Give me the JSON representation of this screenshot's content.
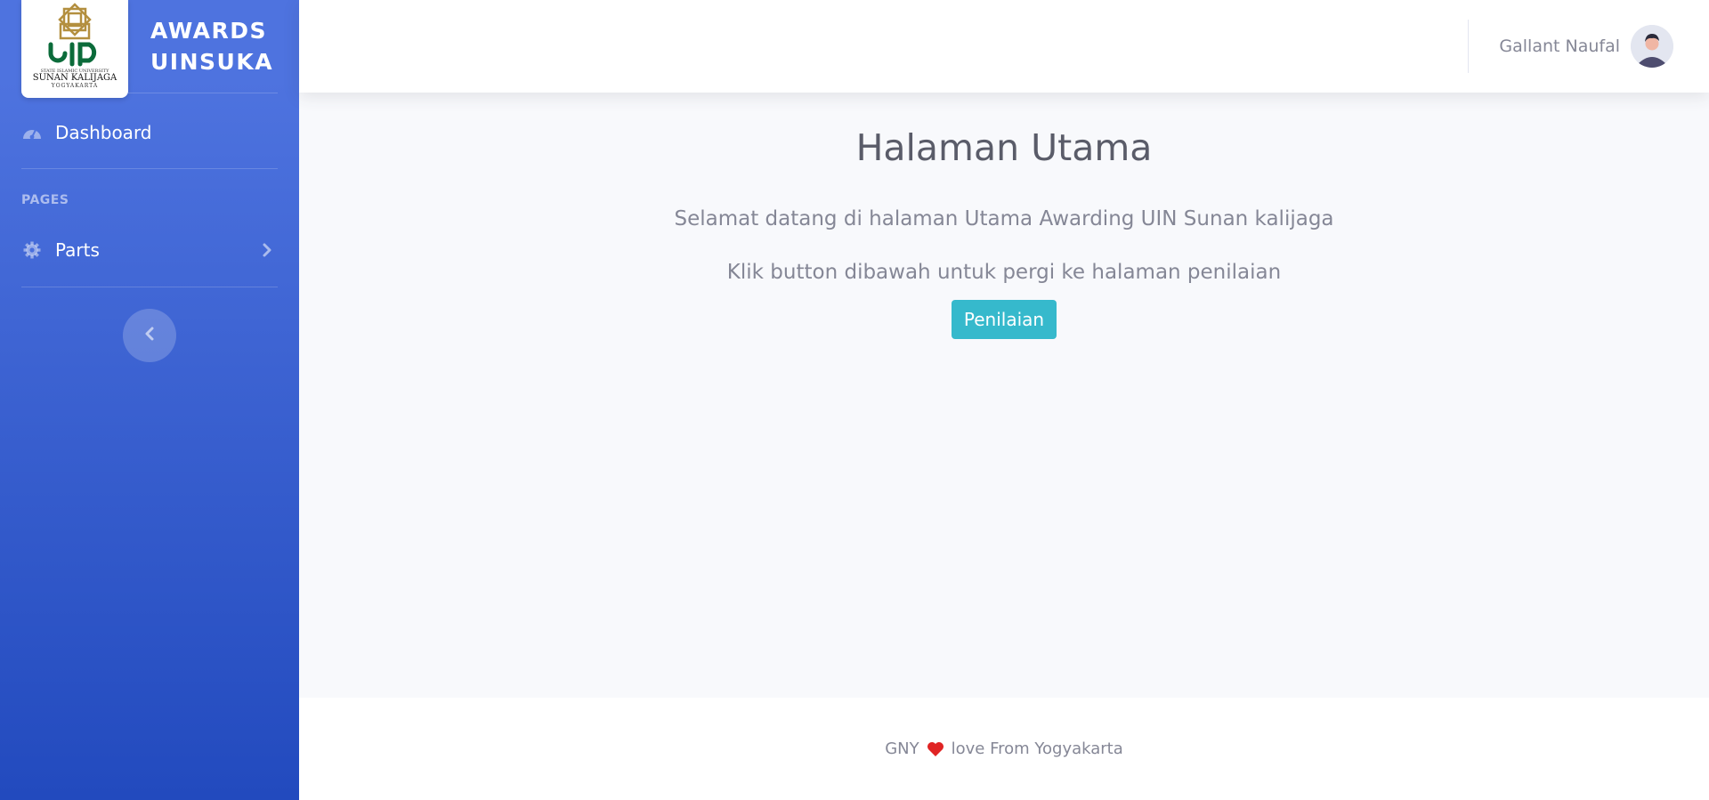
{
  "sidebar": {
    "brand": {
      "logo_text": [
        "STATE ISLAMIC UNIVERSITY",
        "SUNAN KALIJAGA",
        "YOGYAKARTA"
      ],
      "title": "AWARDS\nUINSUKA"
    },
    "items": [
      {
        "label": "Dashboard",
        "icon": "tachometer-icon"
      },
      {
        "heading": "PAGES"
      },
      {
        "label": "Parts",
        "icon": "gear-icon",
        "has_chevron": true
      }
    ],
    "toggle_icon": "chevron-left-icon",
    "colors": {
      "gradient_start": "#4e73df",
      "gradient_end": "#224abe"
    }
  },
  "topbar": {
    "user_name": "Gallant Naufal",
    "avatar_icon": "user-avatar"
  },
  "main": {
    "title": "Halaman Utama",
    "welcome_text": "Selamat datang di halaman Utama Awarding UIN Sunan kalijaga",
    "instruction_text": "Klik button dibawah untuk pergi ke halaman penilaian",
    "button_label": "Penilaian",
    "button_color": "#36b9cc"
  },
  "footer": {
    "before": "GNY",
    "icon": "heart-icon",
    "after": "love From Yogyakarta"
  }
}
